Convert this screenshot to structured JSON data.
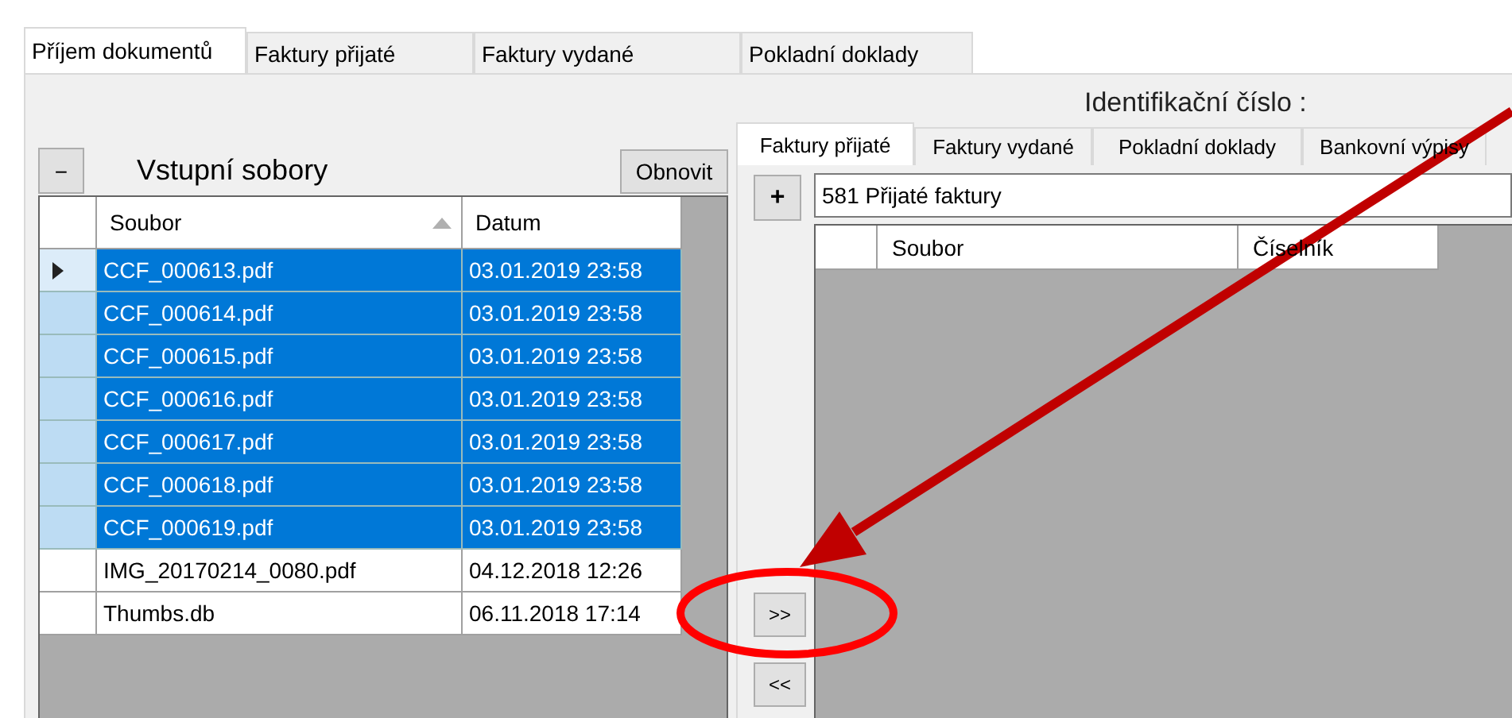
{
  "tabs": [
    {
      "label": "Příjem dokumentů",
      "selected": true
    },
    {
      "label": "Faktury přijaté",
      "selected": false
    },
    {
      "label": "Faktury vydané",
      "selected": false
    },
    {
      "label": "Pokladní doklady",
      "selected": false
    }
  ],
  "left_panel": {
    "collapse_button": "−",
    "title": "Vstupní sobory",
    "refresh_button": "Obnovit",
    "table": {
      "columns": [
        {
          "label": "Soubor",
          "sorted": true
        },
        {
          "label": "Datum",
          "sorted": false
        }
      ],
      "rows": [
        {
          "file": "CCF_000613.pdf",
          "date": "03.01.2019 23:58",
          "selected": true,
          "current": true
        },
        {
          "file": "CCF_000614.pdf",
          "date": "03.01.2019 23:58",
          "selected": true,
          "current": false
        },
        {
          "file": "CCF_000615.pdf",
          "date": "03.01.2019 23:58",
          "selected": true,
          "current": false
        },
        {
          "file": "CCF_000616.pdf",
          "date": "03.01.2019 23:58",
          "selected": true,
          "current": false
        },
        {
          "file": "CCF_000617.pdf",
          "date": "03.01.2019 23:58",
          "selected": true,
          "current": false
        },
        {
          "file": "CCF_000618.pdf",
          "date": "03.01.2019 23:58",
          "selected": true,
          "current": false
        },
        {
          "file": "CCF_000619.pdf",
          "date": "03.01.2019 23:58",
          "selected": true,
          "current": false
        },
        {
          "file": "IMG_20170214_0080.pdf",
          "date": "04.12.2018 12:26",
          "selected": false,
          "current": false
        },
        {
          "file": "Thumbs.db",
          "date": "06.11.2018 17:14",
          "selected": false,
          "current": false
        }
      ]
    }
  },
  "right_panel": {
    "id_label": "Identifikační číslo :",
    "tabs": [
      {
        "label": "Faktury přijaté",
        "selected": true
      },
      {
        "label": "Faktury vydané",
        "selected": false
      },
      {
        "label": "Pokladní doklady",
        "selected": false
      },
      {
        "label": "Bankovní výpisy",
        "selected": false
      }
    ],
    "add_button": "+",
    "category": "581 Přijaté faktury",
    "table": {
      "columns": [
        {
          "label": "Soubor"
        },
        {
          "label": "Číselník"
        }
      ]
    },
    "move_right_button": ">>",
    "move_left_button": "<<"
  },
  "annotation": {
    "arrow": true,
    "circle": true
  }
}
